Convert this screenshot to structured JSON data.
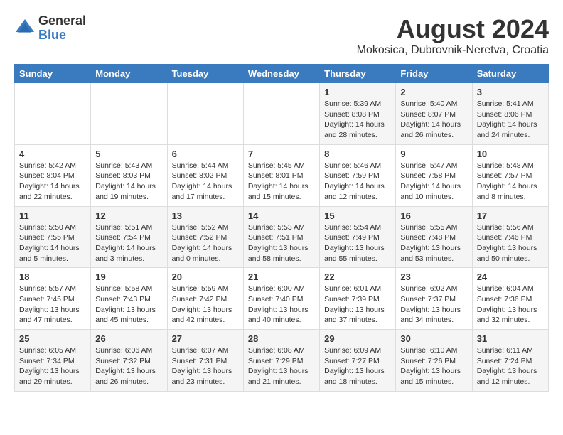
{
  "logo": {
    "general": "General",
    "blue": "Blue"
  },
  "title": {
    "month_year": "August 2024",
    "location": "Mokosica, Dubrovnik-Neretva, Croatia"
  },
  "headers": [
    "Sunday",
    "Monday",
    "Tuesday",
    "Wednesday",
    "Thursday",
    "Friday",
    "Saturday"
  ],
  "weeks": [
    [
      {
        "day": "",
        "content": ""
      },
      {
        "day": "",
        "content": ""
      },
      {
        "day": "",
        "content": ""
      },
      {
        "day": "",
        "content": ""
      },
      {
        "day": "1",
        "content": "Sunrise: 5:39 AM\nSunset: 8:08 PM\nDaylight: 14 hours\nand 28 minutes."
      },
      {
        "day": "2",
        "content": "Sunrise: 5:40 AM\nSunset: 8:07 PM\nDaylight: 14 hours\nand 26 minutes."
      },
      {
        "day": "3",
        "content": "Sunrise: 5:41 AM\nSunset: 8:06 PM\nDaylight: 14 hours\nand 24 minutes."
      }
    ],
    [
      {
        "day": "4",
        "content": "Sunrise: 5:42 AM\nSunset: 8:04 PM\nDaylight: 14 hours\nand 22 minutes."
      },
      {
        "day": "5",
        "content": "Sunrise: 5:43 AM\nSunset: 8:03 PM\nDaylight: 14 hours\nand 19 minutes."
      },
      {
        "day": "6",
        "content": "Sunrise: 5:44 AM\nSunset: 8:02 PM\nDaylight: 14 hours\nand 17 minutes."
      },
      {
        "day": "7",
        "content": "Sunrise: 5:45 AM\nSunset: 8:01 PM\nDaylight: 14 hours\nand 15 minutes."
      },
      {
        "day": "8",
        "content": "Sunrise: 5:46 AM\nSunset: 7:59 PM\nDaylight: 14 hours\nand 12 minutes."
      },
      {
        "day": "9",
        "content": "Sunrise: 5:47 AM\nSunset: 7:58 PM\nDaylight: 14 hours\nand 10 minutes."
      },
      {
        "day": "10",
        "content": "Sunrise: 5:48 AM\nSunset: 7:57 PM\nDaylight: 14 hours\nand 8 minutes."
      }
    ],
    [
      {
        "day": "11",
        "content": "Sunrise: 5:50 AM\nSunset: 7:55 PM\nDaylight: 14 hours\nand 5 minutes."
      },
      {
        "day": "12",
        "content": "Sunrise: 5:51 AM\nSunset: 7:54 PM\nDaylight: 14 hours\nand 3 minutes."
      },
      {
        "day": "13",
        "content": "Sunrise: 5:52 AM\nSunset: 7:52 PM\nDaylight: 14 hours\nand 0 minutes."
      },
      {
        "day": "14",
        "content": "Sunrise: 5:53 AM\nSunset: 7:51 PM\nDaylight: 13 hours\nand 58 minutes."
      },
      {
        "day": "15",
        "content": "Sunrise: 5:54 AM\nSunset: 7:49 PM\nDaylight: 13 hours\nand 55 minutes."
      },
      {
        "day": "16",
        "content": "Sunrise: 5:55 AM\nSunset: 7:48 PM\nDaylight: 13 hours\nand 53 minutes."
      },
      {
        "day": "17",
        "content": "Sunrise: 5:56 AM\nSunset: 7:46 PM\nDaylight: 13 hours\nand 50 minutes."
      }
    ],
    [
      {
        "day": "18",
        "content": "Sunrise: 5:57 AM\nSunset: 7:45 PM\nDaylight: 13 hours\nand 47 minutes."
      },
      {
        "day": "19",
        "content": "Sunrise: 5:58 AM\nSunset: 7:43 PM\nDaylight: 13 hours\nand 45 minutes."
      },
      {
        "day": "20",
        "content": "Sunrise: 5:59 AM\nSunset: 7:42 PM\nDaylight: 13 hours\nand 42 minutes."
      },
      {
        "day": "21",
        "content": "Sunrise: 6:00 AM\nSunset: 7:40 PM\nDaylight: 13 hours\nand 40 minutes."
      },
      {
        "day": "22",
        "content": "Sunrise: 6:01 AM\nSunset: 7:39 PM\nDaylight: 13 hours\nand 37 minutes."
      },
      {
        "day": "23",
        "content": "Sunrise: 6:02 AM\nSunset: 7:37 PM\nDaylight: 13 hours\nand 34 minutes."
      },
      {
        "day": "24",
        "content": "Sunrise: 6:04 AM\nSunset: 7:36 PM\nDaylight: 13 hours\nand 32 minutes."
      }
    ],
    [
      {
        "day": "25",
        "content": "Sunrise: 6:05 AM\nSunset: 7:34 PM\nDaylight: 13 hours\nand 29 minutes."
      },
      {
        "day": "26",
        "content": "Sunrise: 6:06 AM\nSunset: 7:32 PM\nDaylight: 13 hours\nand 26 minutes."
      },
      {
        "day": "27",
        "content": "Sunrise: 6:07 AM\nSunset: 7:31 PM\nDaylight: 13 hours\nand 23 minutes."
      },
      {
        "day": "28",
        "content": "Sunrise: 6:08 AM\nSunset: 7:29 PM\nDaylight: 13 hours\nand 21 minutes."
      },
      {
        "day": "29",
        "content": "Sunrise: 6:09 AM\nSunset: 7:27 PM\nDaylight: 13 hours\nand 18 minutes."
      },
      {
        "day": "30",
        "content": "Sunrise: 6:10 AM\nSunset: 7:26 PM\nDaylight: 13 hours\nand 15 minutes."
      },
      {
        "day": "31",
        "content": "Sunrise: 6:11 AM\nSunset: 7:24 PM\nDaylight: 13 hours\nand 12 minutes."
      }
    ]
  ]
}
